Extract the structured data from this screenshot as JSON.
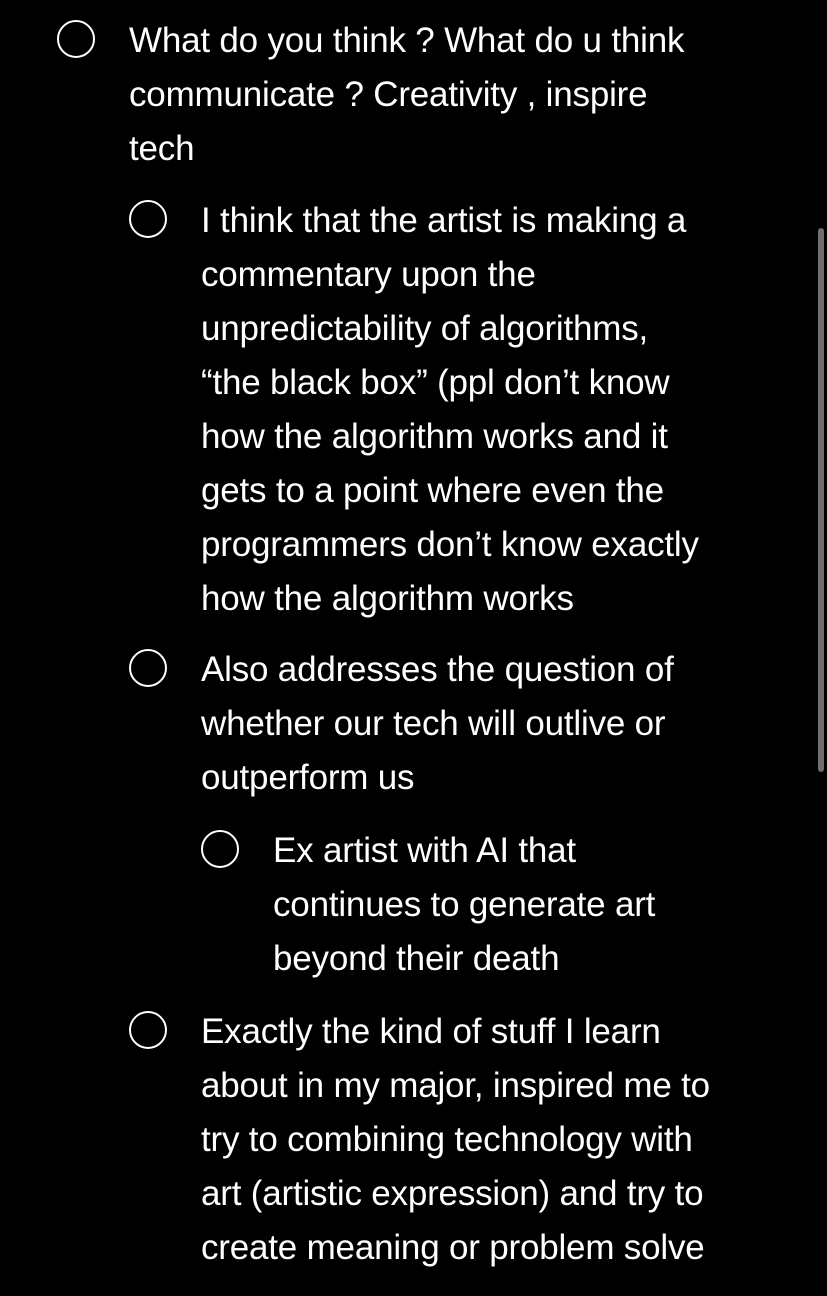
{
  "checklist": {
    "items": [
      {
        "level": 0,
        "checked": false,
        "text": "What do you think ? What do u  think\ncommunicate ? Creativity , inspire\ntech"
      },
      {
        "level": 1,
        "checked": false,
        "text": "I think that the artist is making a\ncommentary upon the\nunpredictability of algorithms,\n“the black box” (ppl don’t know\nhow the algorithm works and it\ngets to a point where even the\nprogrammers don’t know exactly\nhow the algorithm works"
      },
      {
        "level": 1,
        "checked": false,
        "text": "Also addresses the question of\nwhether our tech will outlive or\noutperform us"
      },
      {
        "level": 2,
        "checked": false,
        "text": "Ex artist with AI that\ncontinues to generate art\nbeyond their death"
      },
      {
        "level": 1,
        "checked": false,
        "text": "Exactly the kind of stuff I learn\nabout in my major, inspired me to\ntry to combining technology with\nart (artistic expression) and try to\ncreate meaning or problem solve"
      }
    ]
  },
  "colors": {
    "background": "#000000",
    "text": "#ffffff",
    "checkbox_border": "#ffffff",
    "scrollbar": "#6e6e6e"
  },
  "icons": {
    "checkbox": "empty-circle-checkbox-icon"
  }
}
